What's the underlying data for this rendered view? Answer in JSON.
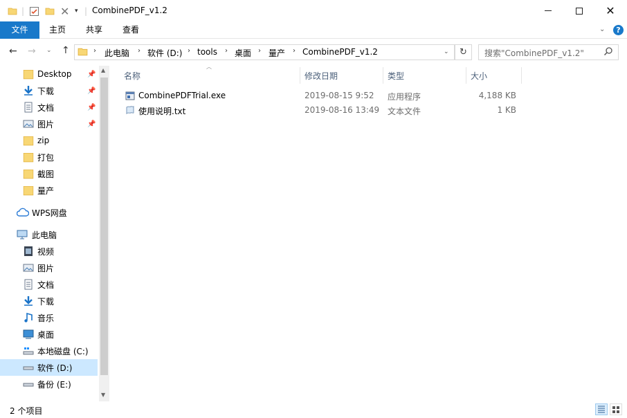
{
  "window": {
    "title": "CombinePDF_v1.2",
    "controls": [
      "minimize",
      "maximize",
      "close"
    ]
  },
  "ribbon": {
    "tabs": [
      "文件",
      "主页",
      "共享",
      "查看"
    ]
  },
  "address": {
    "breadcrumbs": [
      "此电脑",
      "软件 (D:)",
      "tools",
      "桌面",
      "量产",
      "CombinePDF_v1.2"
    ],
    "search_placeholder": "搜索\"CombinePDF_v1.2\""
  },
  "sidebar": {
    "quick_access": [
      {
        "label": "Desktop",
        "icon": "folder-icon",
        "pinned": true
      },
      {
        "label": "下载",
        "icon": "download-icon",
        "pinned": true
      },
      {
        "label": "文档",
        "icon": "document-icon",
        "pinned": true
      },
      {
        "label": "图片",
        "icon": "picture-icon",
        "pinned": true
      },
      {
        "label": "zip",
        "icon": "folder-icon",
        "pinned": false
      },
      {
        "label": "打包",
        "icon": "folder-icon",
        "pinned": false
      },
      {
        "label": "截图",
        "icon": "folder-icon",
        "pinned": false
      },
      {
        "label": "量产",
        "icon": "folder-icon",
        "pinned": false
      }
    ],
    "wps": {
      "label": "WPS网盘",
      "icon": "cloud-icon"
    },
    "this_pc": {
      "label": "此电脑",
      "icon": "computer-icon"
    },
    "pc_items": [
      {
        "label": "视频",
        "icon": "video-icon"
      },
      {
        "label": "图片",
        "icon": "picture-icon"
      },
      {
        "label": "文档",
        "icon": "document-icon"
      },
      {
        "label": "下载",
        "icon": "download-icon"
      },
      {
        "label": "音乐",
        "icon": "music-icon"
      },
      {
        "label": "桌面",
        "icon": "desktop-icon"
      },
      {
        "label": "本地磁盘 (C:)",
        "icon": "drive-icon"
      },
      {
        "label": "软件 (D:)",
        "icon": "drive-icon",
        "selected": true
      },
      {
        "label": "备份 (E:)",
        "icon": "drive-icon"
      }
    ]
  },
  "columns": {
    "name": "名称",
    "modified": "修改日期",
    "type": "类型",
    "size": "大小"
  },
  "files": [
    {
      "name": "CombinePDFTrial.exe",
      "modified": "2019-08-15 9:52",
      "type": "应用程序",
      "size": "4,188 KB",
      "icon": "exe-icon"
    },
    {
      "name": "使用说明.txt",
      "modified": "2019-08-16 13:49",
      "type": "文本文件",
      "size": "1 KB",
      "icon": "txt-icon"
    }
  ],
  "status": {
    "item_count": "2 个项目"
  },
  "colors": {
    "file_tab": "#1979ca",
    "selected_row": "#cce8ff",
    "header_text": "#4c607a"
  }
}
